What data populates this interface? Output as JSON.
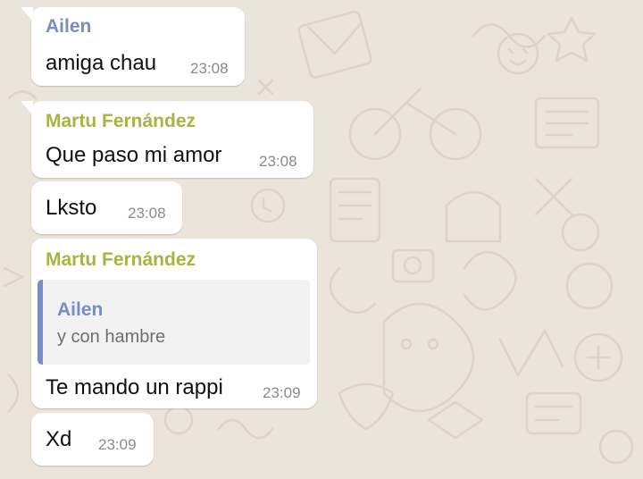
{
  "colors": {
    "wallpaper": "#ebe4da",
    "bubble": "#ffffff",
    "sender_ailen": "#7a8cc4",
    "sender_martu": "#a2b742",
    "timestamp": "#8a8a8a",
    "quote_background": "#f2f2f2"
  },
  "messages": [
    {
      "sender": "Ailen",
      "text": "amiga chau",
      "time": "23:08"
    },
    {
      "sender": "Martu Fernández",
      "text": "Que paso mi amor",
      "time": "23:08"
    },
    {
      "text": "Lksto",
      "time": "23:08"
    },
    {
      "sender": "Martu Fernández",
      "quote": {
        "sender": "Ailen",
        "text": "y con hambre"
      },
      "text": "Te mando un rappi",
      "time": "23:09"
    },
    {
      "text": "Xd",
      "time": "23:09"
    }
  ]
}
